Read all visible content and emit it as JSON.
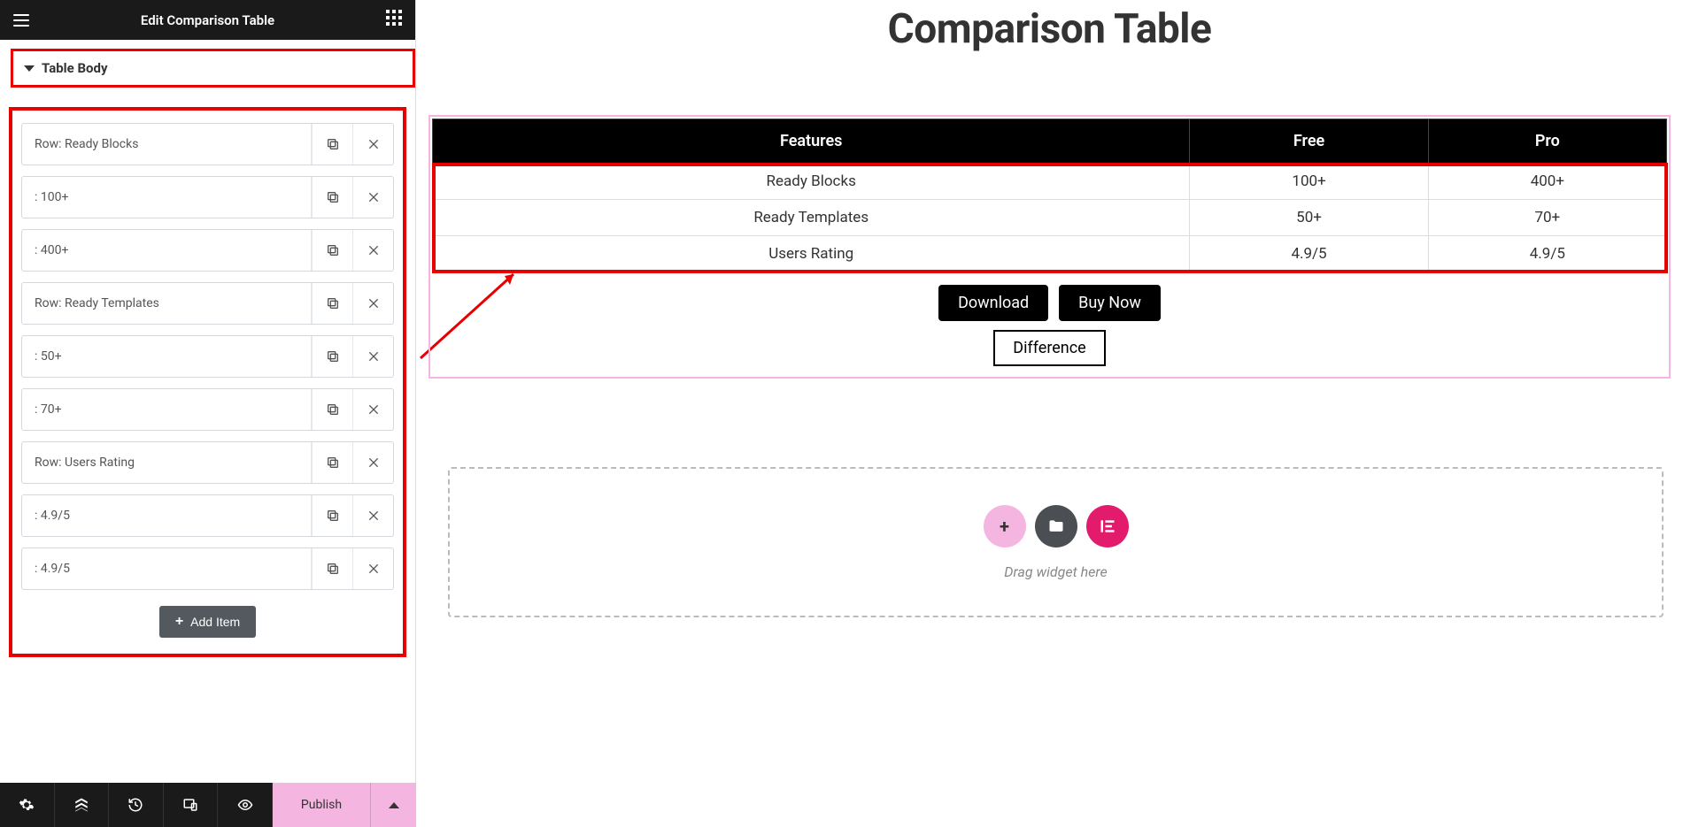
{
  "editor": {
    "title": "Edit Comparison Table",
    "section_label": "Table Body",
    "add_item": "Add Item",
    "items": [
      {
        "label": "Row: Ready Blocks"
      },
      {
        "label": ": 100+"
      },
      {
        "label": ": 400+"
      },
      {
        "label": ": Row: Ready Templates",
        "display": "Row: Ready Templates"
      },
      {
        "label": ": 50+"
      },
      {
        "label": ": 70+"
      },
      {
        "label": "Row: Users Rating"
      },
      {
        "label": ": 4.9/5"
      },
      {
        "label": ": 4.9/5"
      }
    ],
    "publish": "Publish"
  },
  "preview": {
    "title": "Comparison Table",
    "headers": [
      "Features",
      "Free",
      "Pro"
    ],
    "rows": [
      [
        "Ready Blocks",
        "100+",
        "400+"
      ],
      [
        "Ready Templates",
        "50+",
        "70+"
      ],
      [
        "Users Rating",
        "4.9/5",
        "4.9/5"
      ]
    ],
    "buttons": {
      "download": "Download",
      "buy": "Buy Now",
      "diff": "Difference"
    },
    "dropzone_text": "Drag widget here"
  }
}
